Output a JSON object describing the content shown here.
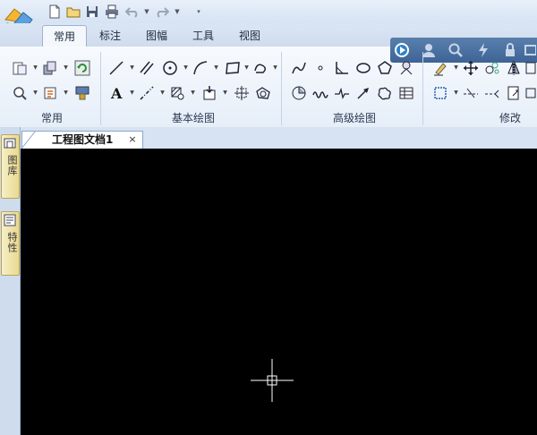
{
  "tabs": [
    {
      "label": "常用",
      "active": true
    },
    {
      "label": "标注",
      "active": false
    },
    {
      "label": "图幅",
      "active": false
    },
    {
      "label": "工具",
      "active": false
    },
    {
      "label": "视图",
      "active": false
    }
  ],
  "ribbon_groups": [
    {
      "label": "常用"
    },
    {
      "label": "基本绘图"
    },
    {
      "label": "高级绘图"
    },
    {
      "label": "修改"
    }
  ],
  "document_tab": {
    "label": "工程图文档1",
    "close": "×"
  },
  "side_tabs": [
    {
      "label": "图库"
    },
    {
      "label": "特性"
    }
  ],
  "colors": {
    "accent": "#3e6497",
    "canvas": "#000000",
    "ribbon": "#eef3fa"
  }
}
